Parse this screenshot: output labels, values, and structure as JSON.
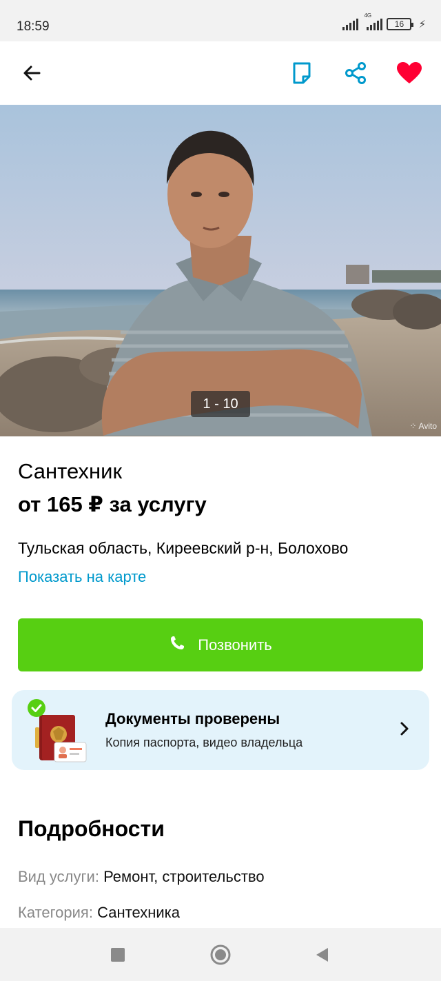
{
  "status_bar": {
    "time": "18:59",
    "network": "4G",
    "battery": "16",
    "icons": [
      "signal-icon",
      "signal-4g-icon",
      "battery-icon",
      "charging-icon"
    ]
  },
  "toolbar": {
    "icons": [
      "back-arrow-icon",
      "note-icon",
      "share-icon",
      "heart-icon"
    ],
    "accent": "#0099cc",
    "favorite_color": "#ff0033"
  },
  "gallery": {
    "counter": "1 - 10",
    "watermark": "Avito"
  },
  "listing": {
    "title": "Сантехник",
    "price": "от 165 ₽ за услугу",
    "address": "Тульская область, Киреевский р-н, Болохово",
    "map_link": "Показать на карте"
  },
  "call_button": {
    "label": "Позвонить",
    "color": "#57cf12",
    "icon": "phone-icon"
  },
  "docs_card": {
    "title": "Документы проверены",
    "subtitle": "Копия паспорта, видео владельца",
    "background": "#e3f3fb",
    "icons": [
      "passport-icon",
      "check-badge-icon",
      "chevron-right-icon"
    ]
  },
  "details": {
    "heading": "Подробности",
    "items": [
      {
        "key": "Вид услуги:",
        "value": "Ремонт, строительство"
      },
      {
        "key": "Категория:",
        "value": "Сантехника"
      }
    ]
  },
  "nav_bar": {
    "icons": [
      "recent-apps-icon",
      "home-icon",
      "back-icon"
    ]
  }
}
